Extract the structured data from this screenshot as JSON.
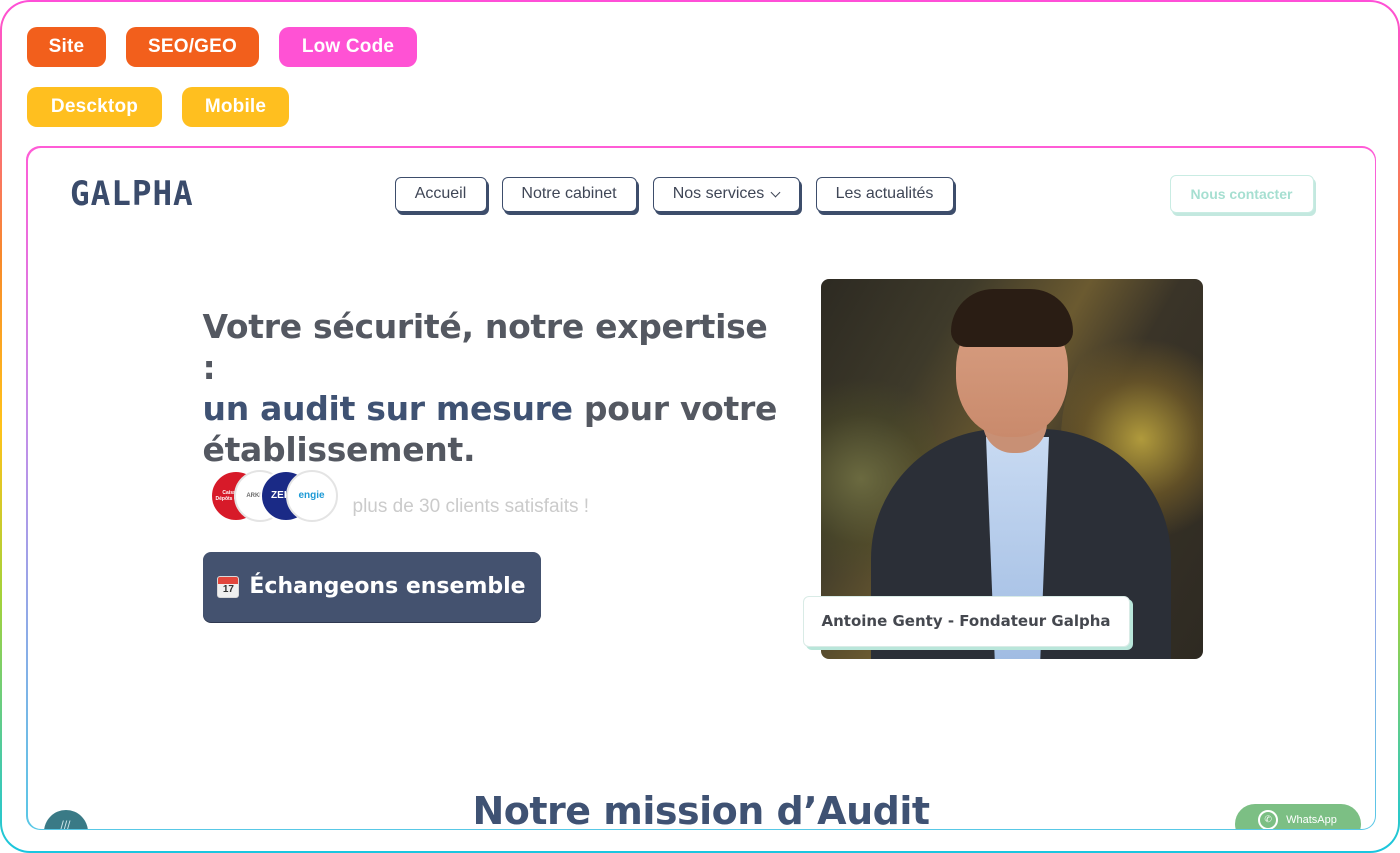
{
  "tags": {
    "site": "Site",
    "seo_geo": "SEO/GEO",
    "low_code": "Low Code",
    "desktop": "Descktop",
    "mobile": "Mobile"
  },
  "site": {
    "logo": "GALPHA",
    "nav": {
      "home": "Accueil",
      "firm": "Notre cabinet",
      "services": "Nos services",
      "news": "Les actualités"
    },
    "contact_button": "Nous contacter",
    "hero": {
      "headline_part1": "Votre sécurité, notre expertise :",
      "headline_accent": "un audit sur mesure",
      "headline_part2": "pour votre établissement.",
      "clients_text": "plus de 30 clients satisfaits !",
      "client_logos": {
        "logo1": "Caisse des Dépôts GROUPE",
        "logo2": "ARKEMA",
        "logo3": "ZEISS",
        "logo4": "engie"
      },
      "cta_icon_text": "17",
      "cta_label": "Échangeons ensemble",
      "photo_caption": "Antoine Genty - Fondateur Galpha"
    },
    "section_title": "Notre mission d’Audit",
    "whatsapp_label": "WhatsApp"
  },
  "colors": {
    "tag_orange": "#f25f1c",
    "tag_pink": "#ff52d4",
    "tag_yellow": "#ffbf1f",
    "brand_navy": "#3f5273",
    "whatsapp_green": "#7cbf84"
  }
}
